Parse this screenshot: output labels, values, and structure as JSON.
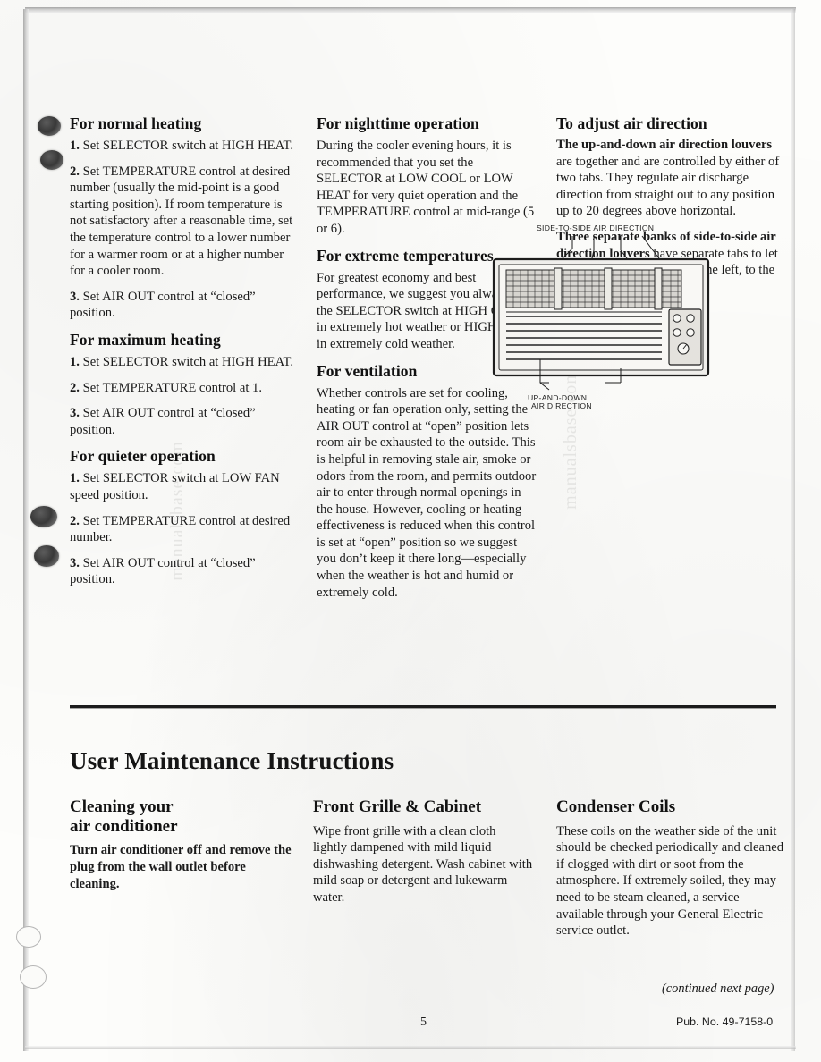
{
  "document": {
    "page_number": "5",
    "pub_no": "Pub. No. 49-7158-0",
    "continued_note": "(continued next page)",
    "watermarks": [
      "manualsbase.com",
      "manualsbase.com"
    ]
  },
  "col_a": {
    "sections": [
      {
        "heading": "For normal heating",
        "paragraphs": [
          {
            "num": "1.",
            "text": " Set SELECTOR switch at HIGH HEAT."
          },
          {
            "num": "2.",
            "text": " Set TEMPERATURE control at desired number (usually the mid-point is a good starting position). If room temperature is not satisfactory after a reasonable time, set the temperature control to a lower number for a warmer room or at a higher number for a cooler room."
          },
          {
            "num": "3.",
            "text": " Set AIR OUT control at “closed” position."
          }
        ]
      },
      {
        "heading": "For maximum heating",
        "paragraphs": [
          {
            "num": "1.",
            "text": " Set SELECTOR switch at HIGH HEAT."
          },
          {
            "num": "2.",
            "text": " Set TEMPERATURE control at 1."
          },
          {
            "num": "3.",
            "text": " Set AIR OUT control at “closed” position."
          }
        ]
      },
      {
        "heading": "For quieter operation",
        "paragraphs": [
          {
            "num": "1.",
            "text": " Set SELECTOR switch at LOW FAN speed position."
          },
          {
            "num": "2.",
            "text": " Set TEMPERATURE control at desired number."
          },
          {
            "num": "3.",
            "text": " Set AIR OUT control at “closed” position."
          }
        ]
      }
    ]
  },
  "col_b": {
    "sections": [
      {
        "heading": "For nighttime operation",
        "body": "During the cooler evening hours, it is recommended that you set the SELECTOR at LOW COOL or LOW HEAT for very quiet operation and the TEMPERATURE control at mid-range (5 or 6)."
      },
      {
        "heading": "For extreme temperatures",
        "body": "For greatest economy and best performance, we suggest you always set the SELECTOR switch at HIGH COOL in extremely hot weather or HIGH HEAT in extremely cold weather."
      },
      {
        "heading": "For ventilation",
        "body": "Whether controls are set for cooling, heating or fan operation only, setting the AIR OUT control at “open” position lets room air be exhausted to the outside. This is helpful in removing stale air, smoke or odors from the room, and permits outdoor air to enter through normal openings in the house. However, cooling or heating effectiveness is reduced when this control is set at “open” position so we suggest you don’t keep it there long—especially when the weather is hot and humid or extremely cold."
      }
    ]
  },
  "col_c": {
    "heading": "To adjust air direction",
    "paragraphs": [
      {
        "lead": "The up-and-down air direction louvers",
        "rest": " are together and are controlled by either of two tabs. They regulate air discharge direction from straight out to any position up to 20 degrees above horizontal."
      },
      {
        "lead": "Three separate banks of side-to-side air direction louvers",
        "rest": " have separate tabs to let you direct discharged air to the left, to the right, or straight ahead."
      }
    ],
    "diagram": {
      "top_label": "SIDE-TO-SIDE AIR DIRECTION",
      "bottom_label_line1": "UP-AND-DOWN",
      "bottom_label_line2": "AIR DIRECTION"
    }
  },
  "maintenance": {
    "title": "User Maintenance Instructions",
    "columns": [
      {
        "heading_line1": "Cleaning your",
        "heading_line2": "air conditioner",
        "body_bold": "Turn air conditioner off and remove the plug from the wall outlet before cleaning."
      },
      {
        "heading_line1": "Front Grille & Cabinet",
        "heading_line2": "",
        "body": "Wipe front grille with a clean cloth lightly dampened with mild liquid dishwashing detergent. Wash cabinet with mild soap or detergent and lukewarm water."
      },
      {
        "heading_line1": "Condenser Coils",
        "heading_line2": "",
        "body": "These coils on the weather side of the unit should be checked periodically and cleaned if clogged with dirt or soot from the atmosphere. If extremely soiled, they may need to be steam cleaned, a service available through your General Electric service outlet."
      }
    ]
  }
}
